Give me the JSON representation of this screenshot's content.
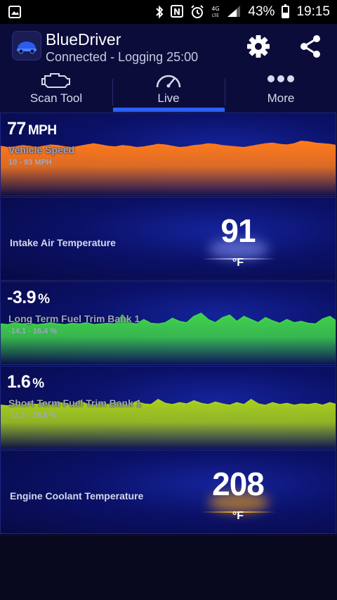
{
  "status_bar": {
    "battery": "43%",
    "time": "19:15",
    "icons": [
      "image-icon",
      "bluetooth-icon",
      "nfc-icon",
      "alarm-icon",
      "4g-lte-icon",
      "signal-icon",
      "battery-icon"
    ]
  },
  "app": {
    "title": "BlueDriver",
    "subtitle": "Connected - Logging 25:00",
    "actions": [
      "settings-icon",
      "share-icon"
    ]
  },
  "tabs": [
    {
      "label": "Scan Tool",
      "icon": "engine-icon",
      "active": false
    },
    {
      "label": "Live",
      "icon": "speedometer-icon",
      "active": true
    },
    {
      "label": "More",
      "icon": "more-dots-icon",
      "active": false
    }
  ],
  "gauges": [
    {
      "type": "graph",
      "value": "77",
      "unit": "MPH",
      "name": "Vehicle Speed",
      "range": "10 - 93 MPH",
      "color": "#ff7a1a",
      "series": [
        0.62,
        0.6,
        0.61,
        0.63,
        0.62,
        0.6,
        0.62,
        0.64,
        0.63,
        0.61,
        0.6,
        0.62,
        0.64,
        0.66,
        0.64,
        0.62,
        0.61,
        0.63,
        0.62,
        0.6,
        0.61,
        0.63,
        0.65,
        0.64,
        0.62,
        0.6,
        0.61,
        0.63,
        0.64,
        0.66,
        0.65,
        0.63,
        0.62,
        0.61,
        0.6,
        0.62,
        0.64,
        0.66,
        0.67,
        0.65,
        0.64,
        0.66,
        0.7,
        0.69,
        0.67,
        0.66,
        0.65,
        0.63
      ]
    },
    {
      "type": "center",
      "value": "91",
      "unit": "°F",
      "name": "Intake Air Temperature",
      "color": "#8e9dff"
    },
    {
      "type": "graph",
      "value": "-3.9",
      "unit": "%",
      "name": "Long Term Fuel Trim Bank 1",
      "range": "-14.1 - 16.4 %",
      "color": "#3fd24a",
      "series": [
        0.48,
        0.47,
        0.5,
        0.48,
        0.49,
        0.47,
        0.48,
        0.5,
        0.48,
        0.47,
        0.49,
        0.48,
        0.5,
        0.47,
        0.48,
        0.49,
        0.48,
        0.62,
        0.5,
        0.48,
        0.55,
        0.49,
        0.48,
        0.5,
        0.57,
        0.52,
        0.5,
        0.6,
        0.65,
        0.55,
        0.5,
        0.58,
        0.62,
        0.52,
        0.6,
        0.55,
        0.5,
        0.58,
        0.53,
        0.49,
        0.55,
        0.5,
        0.52,
        0.49,
        0.48,
        0.56,
        0.6,
        0.52
      ]
    },
    {
      "type": "graph",
      "value": "1.6",
      "unit": "%",
      "name": "Short Term Fuel Trim Bank 1",
      "range": "-11.7 - 18.8 %",
      "color": "#a8cf1c",
      "series": [
        0.53,
        0.52,
        0.55,
        0.53,
        0.56,
        0.54,
        0.57,
        0.53,
        0.58,
        0.55,
        0.53,
        0.6,
        0.55,
        0.53,
        0.56,
        0.54,
        0.57,
        0.55,
        0.53,
        0.59,
        0.55,
        0.54,
        0.62,
        0.56,
        0.54,
        0.57,
        0.55,
        0.6,
        0.56,
        0.54,
        0.58,
        0.55,
        0.53,
        0.57,
        0.54,
        0.62,
        0.55,
        0.53,
        0.57,
        0.54,
        0.56,
        0.53,
        0.55,
        0.54,
        0.56,
        0.53,
        0.57,
        0.54
      ]
    },
    {
      "type": "center",
      "value": "208",
      "unit": "°F",
      "name": "Engine Coolant Temperature",
      "color": "#f2a316"
    }
  ]
}
